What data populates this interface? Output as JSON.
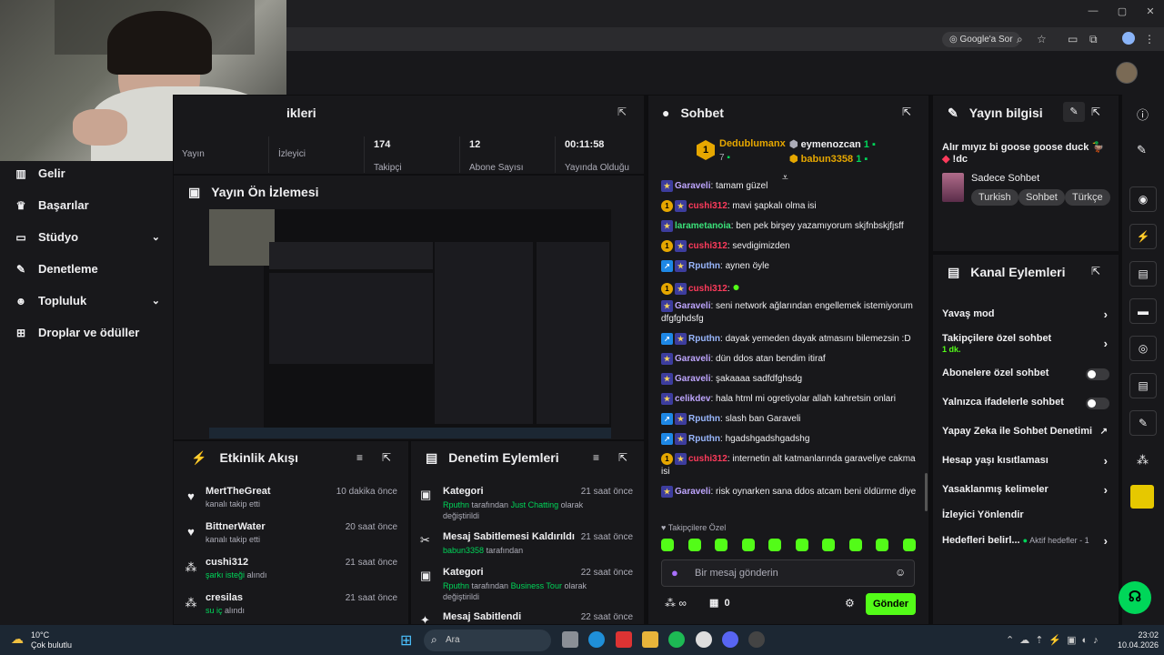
{
  "browser": {
    "google_lens_label": "Google'a Sor"
  },
  "sidebar": {
    "items": [
      {
        "label": "Gelir",
        "icon": "revenue-icon"
      },
      {
        "label": "Başarılar",
        "icon": "trophy-icon"
      },
      {
        "label": "Stüdyo",
        "icon": "studio-icon"
      },
      {
        "label": "Denetleme",
        "icon": "wrench-icon"
      },
      {
        "label": "Topluluk",
        "icon": "community-icon"
      },
      {
        "label": "Droplar ve ödüller",
        "icon": "drops-icon"
      }
    ]
  },
  "stats_panel": {
    "title_partial": "ikleri",
    "stats": [
      {
        "value": "",
        "label": "Yayın"
      },
      {
        "value": "",
        "label": "İzleyici"
      },
      {
        "value": "174",
        "label": "Takipçi"
      },
      {
        "value": "12",
        "label": "Abone Sayısı"
      },
      {
        "value": "00:11:58",
        "label": "Yayında Olduğu"
      }
    ]
  },
  "preview_panel": {
    "title": "Yayın Ön İzlemesi"
  },
  "activity_panel": {
    "title": "Etkinlik Akışı",
    "items": [
      {
        "name": "MertTheGreat",
        "time": "10 dakika önce",
        "desc": "kanalı takip etti",
        "highlight": ""
      },
      {
        "name": "BittnerWater",
        "time": "20 saat önce",
        "desc": "kanalı takip etti",
        "highlight": ""
      },
      {
        "name": "cushi312",
        "time": "21 saat önce",
        "highlight": "şarkı isteği",
        "desc": " alındı"
      },
      {
        "name": "cresilas",
        "time": "21 saat önce",
        "highlight": "su iç",
        "desc": " alındı"
      }
    ]
  },
  "mod_panel": {
    "title": "Denetim Eylemleri",
    "items": [
      {
        "title": "Kategori",
        "time": "21 saat önce",
        "user": "Rputhn",
        "mid": " tarafından ",
        "target": "Just Chatting",
        "rest": " olarak değiştirildi"
      },
      {
        "title": "Mesaj Sabitlemesi Kaldırıldı",
        "time": "21 saat önce",
        "user": "babun3358",
        "mid": " tarafından",
        "target": "",
        "rest": ""
      },
      {
        "title": "Kategori",
        "time": "22 saat önce",
        "user": "Rputhn",
        "mid": " tarafından ",
        "target": "Business Tour",
        "rest": " olarak değiştirildi"
      },
      {
        "title": "Mesaj Sabitlendi",
        "time": "22 saat önce",
        "user": "",
        "mid": "",
        "target": "",
        "rest": ""
      }
    ]
  },
  "chat": {
    "title": "Sohbet",
    "leaderboard": [
      {
        "rank": "1",
        "name": "Dedublumanx",
        "count": "7"
      },
      {
        "rank": "",
        "name": "eymenozcan",
        "count": "1"
      },
      {
        "rank": "",
        "name": "babun3358",
        "count": "1"
      }
    ],
    "messages": [
      {
        "user": "Garaveli",
        "color": "#bfa6ff",
        "badges": [
          "star"
        ],
        "text": "tamam güzel"
      },
      {
        "user": "cushi312",
        "color": "#ff3b5c",
        "badges": [
          "gold",
          "star"
        ],
        "text": "mavi şapkalı olma isi"
      },
      {
        "user": "larametanoia",
        "color": "#3be27a",
        "badges": [
          "star"
        ],
        "text": "ben pek birşey yazamıyorum skjfnbskjfjsff"
      },
      {
        "user": "cushi312",
        "color": "#ff3b5c",
        "badges": [
          "gold",
          "star"
        ],
        "text": "sevdigimizden"
      },
      {
        "user": "Rputhn",
        "color": "#9ab8ff",
        "badges": [
          "arrow",
          "star"
        ],
        "text": "aynen öyle"
      },
      {
        "user": "cushi312",
        "color": "#ff3b5c",
        "badges": [
          "gold",
          "star"
        ],
        "text": ""
      },
      {
        "user": "Garaveli",
        "color": "#bfa6ff",
        "badges": [
          "star"
        ],
        "text": "seni network ağlarından engellemek istemiyorum dfgfghdsfg"
      },
      {
        "user": "Rputhn",
        "color": "#9ab8ff",
        "badges": [
          "arrow",
          "star"
        ],
        "text": "dayak yemeden dayak atmasını bilemezsin :D"
      },
      {
        "user": "Garaveli",
        "color": "#bfa6ff",
        "badges": [
          "star"
        ],
        "text": "dün ddos atan bendim itiraf"
      },
      {
        "user": "Garaveli",
        "color": "#bfa6ff",
        "badges": [
          "star"
        ],
        "text": "şakaaaa sadfdfghsdg"
      },
      {
        "user": "celikdev",
        "color": "#bfa6ff",
        "badges": [
          "star"
        ],
        "text": "hala html mi ogretiyolar allah kahretsin onlari"
      },
      {
        "user": "Rputhn",
        "color": "#9ab8ff",
        "badges": [
          "arrow",
          "star"
        ],
        "text": "slash ban Garaveli"
      },
      {
        "user": "Rputhn",
        "color": "#9ab8ff",
        "badges": [
          "arrow",
          "star"
        ],
        "text": "hgadshgadshgadshg"
      },
      {
        "user": "cushi312",
        "color": "#ff3b5c",
        "badges": [
          "gold",
          "star"
        ],
        "text": "internetin alt katmanlarında garaveliye cakma isi"
      },
      {
        "user": "Garaveli",
        "color": "#bfa6ff",
        "badges": [
          "star"
        ],
        "text": "risk oynarken sana ddos atcam beni öldürme diye"
      }
    ],
    "followers_only_label": "Takipçilere Özel",
    "input_placeholder": "Bir mesaj gönderin",
    "points": "0",
    "send_label": "Gönder"
  },
  "stream_info": {
    "title": "Yayın bilgisi",
    "stream_title": "Alır mıyız bi goose goose duck",
    "stream_title_2": "!dc",
    "category": "Sadece Sohbet",
    "tags": [
      "Turkish",
      "Sohbet",
      "Türkçe"
    ]
  },
  "channel_actions": {
    "title": "Kanal Eylemleri",
    "rows": [
      {
        "label": "Yavaş mod",
        "type": "chevron",
        "sub": ""
      },
      {
        "label": "Takipçilere özel sohbet",
        "type": "chevron",
        "sub": "1 dk."
      },
      {
        "label": "Abonelere özel sohbet",
        "type": "toggle",
        "sub": ""
      },
      {
        "label": "Yalnızca ifadelerle sohbet",
        "type": "toggle",
        "sub": ""
      },
      {
        "label": "Yapay Zeka ile Sohbet Denetimi",
        "type": "external",
        "sub": ""
      },
      {
        "label": "Hesap yaşı kısıtlaması",
        "type": "chevron",
        "sub": ""
      },
      {
        "label": "Yasaklanmış kelimeler",
        "type": "chevron",
        "sub": ""
      },
      {
        "label": "İzleyici Yönlendir",
        "type": "none",
        "sub": ""
      },
      {
        "label": "Hedefleri belirl...",
        "type": "chevron",
        "sub": "Aktif hedefler - 1"
      }
    ]
  },
  "taskbar": {
    "temp": "10°C",
    "weather": "Çok bulutlu",
    "search_placeholder": "Ara",
    "time": "23:02",
    "date": "10.04.2026"
  },
  "colors": {
    "accent": "#53fc18",
    "bg": "#0e0e10",
    "panel": "#18181b"
  }
}
